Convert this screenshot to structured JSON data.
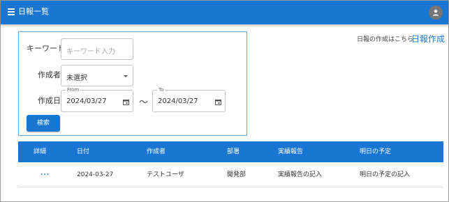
{
  "appbar": {
    "title": "日報一覧",
    "menu_icon": "menu-icon",
    "avatar_icon": "account-icon"
  },
  "search": {
    "keyword_label": "キーワード",
    "keyword_placeholder": "キーワード入力",
    "author_label": "作成者",
    "author_value": "未選択",
    "date_label": "作成日",
    "from_label": "From",
    "from_value": "2024/03/27",
    "range_separator": "〜",
    "to_label": "To",
    "to_value": "2024/03/27",
    "search_button": "検索"
  },
  "create": {
    "note": "日報の作成はこちら",
    "link": "日報作成"
  },
  "table": {
    "headers": [
      "詳細",
      "日付",
      "作成者",
      "部署",
      "実績報告",
      "明日の予定"
    ],
    "rows": [
      {
        "detail": "...",
        "date": "2024-03-27",
        "author": "テストユーザ",
        "department": "開発部",
        "report": "実績報告の記入",
        "plan": "明日の予定の記入"
      }
    ]
  }
}
